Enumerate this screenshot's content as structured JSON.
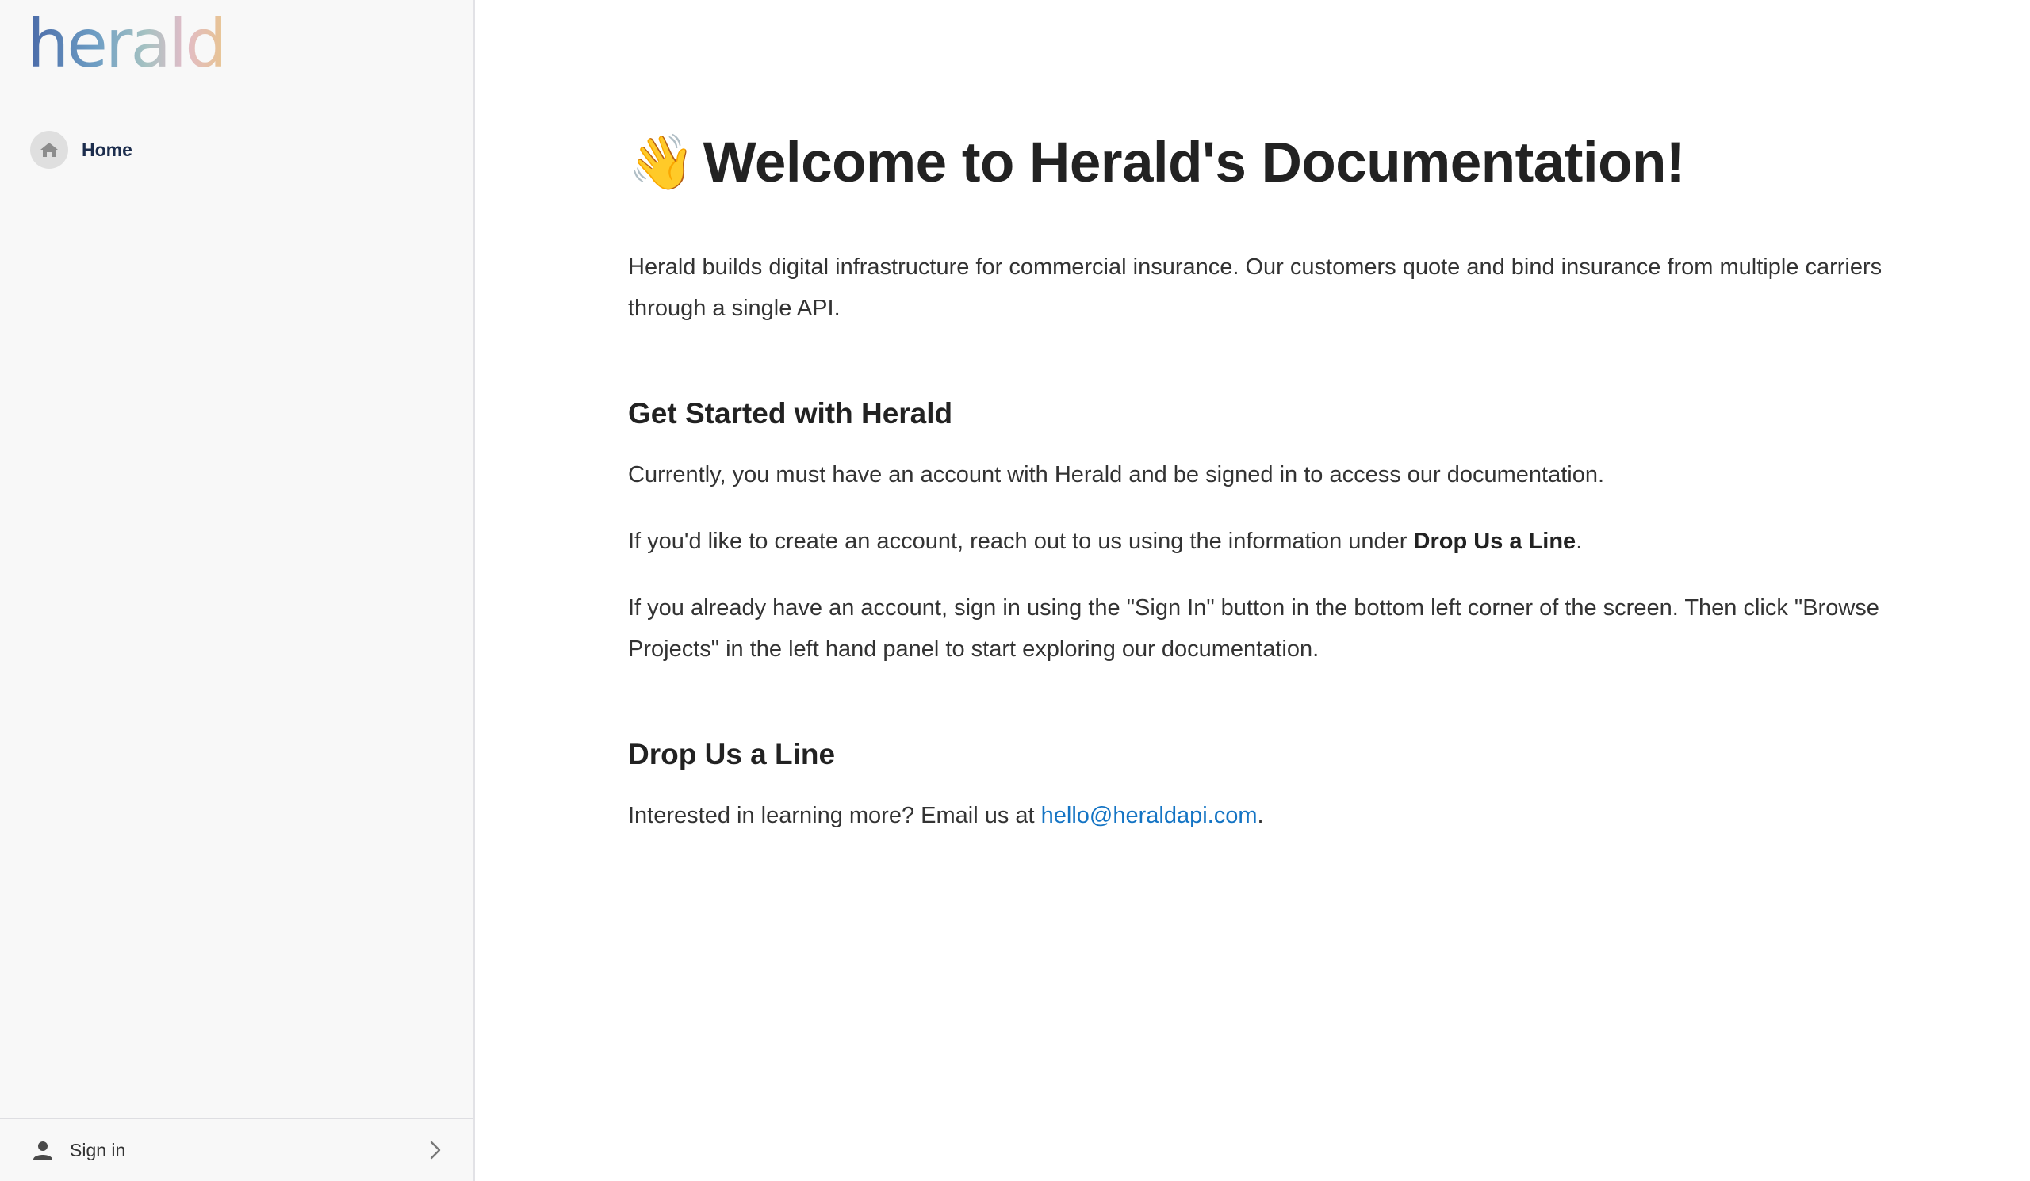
{
  "sidebar": {
    "logo_text": "herald",
    "nav_items": [
      {
        "label": "Home",
        "icon": "home-icon"
      }
    ],
    "signin": {
      "label": "Sign in",
      "icon": "person-icon",
      "chevron_icon": "chevron-right-icon"
    }
  },
  "main": {
    "title_emoji": "👋",
    "title": "Welcome to Herald's Documentation!",
    "intro": "Herald builds digital infrastructure for commercial insurance. Our customers quote and bind insurance from multiple carriers through a single API.",
    "get_started": {
      "heading": "Get Started with Herald",
      "p1": "Currently, you must have an account with Herald and be signed in to access our documentation.",
      "p2_before": "If you'd like to create an account, reach out to us using the information under ",
      "p2_bold": "Drop Us a Line",
      "p2_after": ".",
      "p3": "If you already have an account, sign in using the \"Sign In\" button in the bottom left corner of the screen. Then click \"Browse Projects\" in the left hand panel to start exploring our documentation."
    },
    "drop_line": {
      "heading": "Drop Us a Line",
      "text_before": "Interested in learning more? Email us at ",
      "email": "hello@heraldapi.com",
      "text_after": "."
    }
  },
  "colors": {
    "sidebar_bg": "#f8f8f8",
    "link": "#1474c4",
    "nav_label": "#1c2d4d"
  }
}
